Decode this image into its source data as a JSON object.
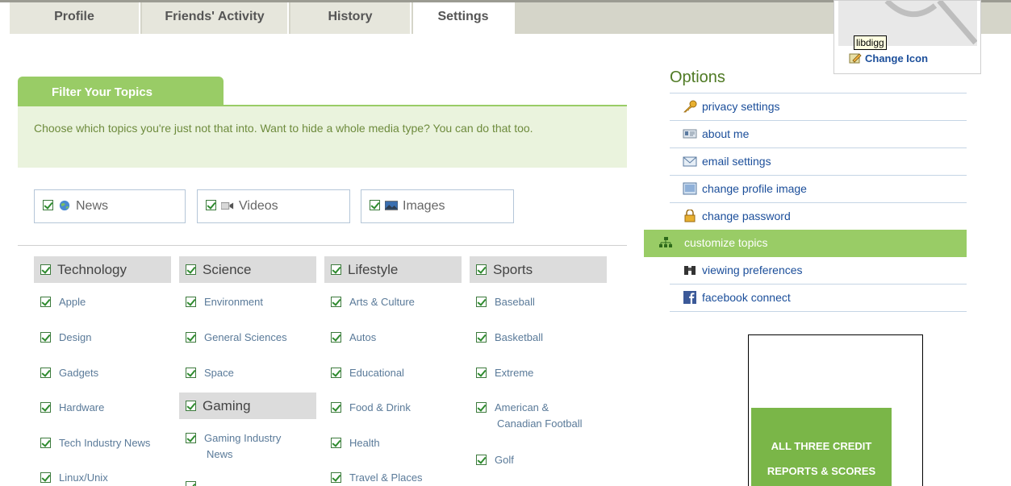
{
  "tabs": [
    {
      "label": "Profile"
    },
    {
      "label": "Friends' Activity"
    },
    {
      "label": "History"
    },
    {
      "label": "Settings"
    }
  ],
  "avatar": {
    "tooltip": "libdigg",
    "change_icon_label": "Change Icon"
  },
  "filter": {
    "tab_title": "Filter Your Topics",
    "description": "Choose which topics you're just not that into. Want to hide a whole media type? You can do that too."
  },
  "media_types": [
    {
      "label": "News",
      "icon": "globe-icon",
      "checked": true
    },
    {
      "label": "Videos",
      "icon": "video-camera-icon",
      "checked": true
    },
    {
      "label": "Images",
      "icon": "image-icon",
      "checked": true
    }
  ],
  "categories": {
    "technology": {
      "label": "Technology",
      "topics": [
        "Apple",
        "Design",
        "Gadgets",
        "Hardware",
        "Tech Industry News",
        "Linux/Unix"
      ]
    },
    "science": {
      "label": "Science",
      "topics": [
        "Environment",
        "General Sciences",
        "Space"
      ]
    },
    "gaming": {
      "label": "Gaming",
      "topics": [
        "Gaming Industry",
        "News"
      ]
    },
    "lifestyle": {
      "label": "Lifestyle",
      "topics": [
        "Arts & Culture",
        "Autos",
        "Educational",
        "Food & Drink",
        "Health",
        "Travel & Places"
      ]
    },
    "sports": {
      "label": "Sports",
      "topics": [
        "Baseball",
        "Basketball",
        "Extreme",
        "American &",
        "Canadian Football",
        "Golf"
      ]
    }
  },
  "options": {
    "title": "Options",
    "items": [
      {
        "label": "privacy settings",
        "icon": "key-icon"
      },
      {
        "label": "about me",
        "icon": "id-card-icon"
      },
      {
        "label": "email settings",
        "icon": "envelope-icon"
      },
      {
        "label": "change profile image",
        "icon": "picture-icon"
      },
      {
        "label": "change password",
        "icon": "lock-icon"
      },
      {
        "label": "customize topics",
        "icon": "hierarchy-icon",
        "active": true
      },
      {
        "label": "viewing preferences",
        "icon": "binoculars-icon"
      },
      {
        "label": "facebook connect",
        "icon": "facebook-icon"
      }
    ]
  },
  "ad": {
    "line1": "ALL THREE CREDIT",
    "line2": "REPORTS & SCORES"
  },
  "colors": {
    "accent_green": "#99cc66",
    "link_blue": "#1b4e9a",
    "topic_blue": "#5a7a99"
  }
}
